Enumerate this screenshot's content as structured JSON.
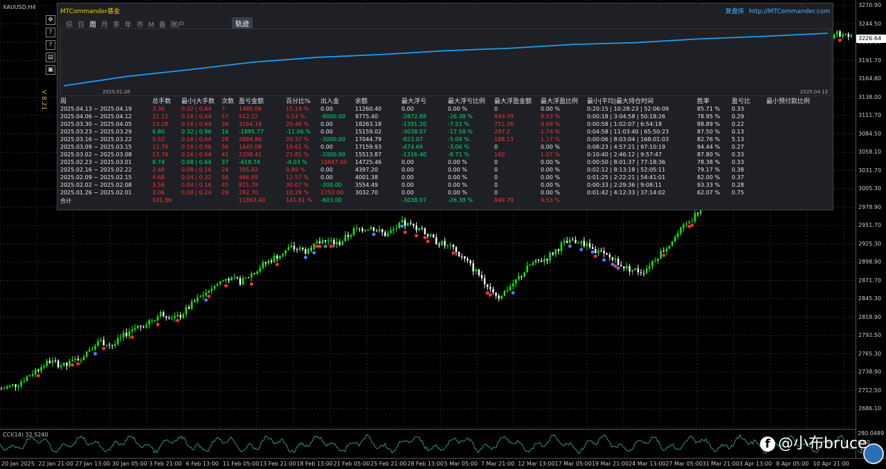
{
  "symbol": "XAUUSD,H4",
  "version": "V 8.21",
  "side_buttons": [
    "✥",
    "?",
    "?",
    "▤",
    "▣"
  ],
  "panel": {
    "title": "MTCommander基金",
    "fupan_label": "复盘侠",
    "url": "http://MTCommander.com",
    "tabs": [
      "综",
      "日",
      "周",
      "月",
      "季",
      "年",
      "市",
      "M",
      "备",
      "账户"
    ],
    "active_tab": "周",
    "trace_tab": "轨迹",
    "equity_start_label": "2025.01.26",
    "equity_end_label": "2025.04.13",
    "equity_points": [
      1000,
      1150,
      1260,
      1380,
      1455,
      1500,
      1560,
      1600,
      1660,
      1690,
      1750,
      1790,
      1840
    ]
  },
  "colors": {
    "bull": "#00ff00",
    "bear": "#ffffff",
    "equity_line": "#1e9cf0",
    "positive": "#00e070",
    "negative": "#ff3030"
  },
  "table": {
    "headers": [
      "周",
      "总手数",
      "最小|大手数",
      "次数",
      "盈亏金额",
      "百分比%",
      "出入金",
      "余额",
      "最大浮亏",
      "最大浮亏比例",
      "最大浮盈金额",
      "最大浮盈比例",
      "最小|平均|最大持仓时间",
      "胜率",
      "盈亏比",
      "最小预付款比例"
    ],
    "rows": [
      {
        "cells": [
          "2025.04.13 ~ 2025.04.19",
          "3.36",
          "0.32 | 0.64",
          "7",
          "1485.06",
          "15.19 %",
          "0.00",
          "11260.40",
          "0.00",
          "0.00 %",
          "0",
          "0.00 %",
          "0:20:15 | 10:28:23 | 52:06:09",
          "85.71 %",
          "0.33",
          ""
        ],
        "tone": [
          "w",
          "r",
          "r",
          "r",
          "r",
          "r",
          "w",
          "w",
          "w",
          "w",
          "w",
          "w",
          "w",
          "w",
          "w",
          "w"
        ]
      },
      {
        "cells": [
          "2025.04.06 ~ 2025.04.12",
          "21.12",
          "0.16 | 0.64",
          "57",
          "512.22",
          "5.53 %",
          "-9000.00",
          "9775.40",
          "-2872.88",
          "-26.38 %",
          "849.79",
          "9.53 %",
          "0:00:18 | 3:04:58 | 50:18:26",
          "78.95 %",
          "0.29",
          ""
        ],
        "tone": [
          "w",
          "r",
          "r",
          "r",
          "r",
          "r",
          "g",
          "w",
          "g",
          "g",
          "r",
          "r",
          "w",
          "w",
          "w",
          "w"
        ]
      },
      {
        "cells": [
          "2025.03.30 ~ 2025.04.05",
          "13.28",
          "0.16 | 0.64",
          "36",
          "3164.18",
          "20.48 %",
          "0.00",
          "18263.18",
          "-1351.20",
          "-7.51 %",
          "751.36",
          "4.69 %",
          "0:00:58 | 1:02:07 | 6:54:18",
          "88.89 %",
          "0.22",
          ""
        ],
        "tone": [
          "w",
          "r",
          "r",
          "r",
          "r",
          "r",
          "w",
          "w",
          "g",
          "g",
          "r",
          "r",
          "w",
          "w",
          "w",
          "w"
        ]
      },
      {
        "cells": [
          "2025.03.23 ~ 2025.03.29",
          "6.80",
          "0.32 | 0.96",
          "16",
          "-1885.77",
          "-11.06 %",
          "0.00",
          "15159.02",
          "-3038.07",
          "-17.58 %",
          "287.2",
          "1.74 %",
          "0:04:58 | 11:03:40 | 65:50:23",
          "87.50 %",
          "0.13",
          ""
        ],
        "tone": [
          "w",
          "g",
          "g",
          "g",
          "g",
          "g",
          "w",
          "w",
          "g",
          "g",
          "r",
          "r",
          "w",
          "w",
          "w",
          "w"
        ]
      },
      {
        "cells": [
          "2025.03.16 ~ 2025.03.22",
          "9.52",
          "0.16 | 0.64",
          "28",
          "2884.86",
          "20.37 %",
          "-3000.00",
          "17044.79",
          "-823.07",
          "-5.04 %",
          "188.13",
          "1.17 %",
          "0:00:06 | 8:03:04 | 168:01:03",
          "82.76 %",
          "5.13",
          ""
        ],
        "tone": [
          "w",
          "r",
          "r",
          "r",
          "r",
          "r",
          "g",
          "w",
          "g",
          "g",
          "r",
          "r",
          "w",
          "w",
          "w",
          "w"
        ]
      },
      {
        "cells": [
          "2025.03.09 ~ 2025.03.15",
          "11.76",
          "0.16 | 0.96",
          "36",
          "1645.08",
          "10.61 %",
          "0.00",
          "17159.93",
          "-474.69",
          "-3.06 %",
          "0",
          "0.00 %",
          "0:08:23 | 4:57:21 | 97:10:19",
          "94.44 %",
          "0.27",
          ""
        ],
        "tone": [
          "w",
          "r",
          "r",
          "r",
          "r",
          "r",
          "w",
          "w",
          "g",
          "g",
          "w",
          "w",
          "w",
          "w",
          "w",
          "w"
        ]
      },
      {
        "cells": [
          "2025.03.02 ~ 2025.03.08",
          "13.76",
          "0.16 | 0.64",
          "41",
          "2208.41",
          "21.81 %",
          "-2000.00",
          "15513.87",
          "-1316.40",
          "-8.71 %",
          "160",
          "1.07 %",
          "0:10:40 | 2:46:12 | 9:57:47",
          "87.80 %",
          "0.33",
          ""
        ],
        "tone": [
          "w",
          "r",
          "r",
          "r",
          "r",
          "r",
          "g",
          "w",
          "g",
          "g",
          "r",
          "r",
          "w",
          "w",
          "w",
          "w"
        ]
      },
      {
        "cells": [
          "2025.02.23 ~ 2025.03.01",
          "8.74",
          "0.08 | 0.64",
          "37",
          "-618.74",
          "-4.03 %",
          "10847.00",
          "14725.46",
          "0.00",
          "0.00 %",
          "0",
          "0.00 %",
          "0:00:50 | 8:01:37 | 77:18:36",
          "78.38 %",
          "0.33",
          ""
        ],
        "tone": [
          "w",
          "g",
          "g",
          "g",
          "g",
          "g",
          "r",
          "w",
          "w",
          "w",
          "w",
          "w",
          "w",
          "w",
          "w",
          "w"
        ]
      },
      {
        "cells": [
          "2025.02.16 ~ 2025.02.22",
          "2.48",
          "0.08 | 0.16",
          "24",
          "395.82",
          "9.89 %",
          "0.00",
          "4397.20",
          "0.00",
          "0.00 %",
          "0",
          "0.00 %",
          "0:02:12 | 8:13:18 | 52:05:11",
          "79.17 %",
          "0.38",
          ""
        ],
        "tone": [
          "w",
          "r",
          "r",
          "r",
          "r",
          "r",
          "w",
          "w",
          "w",
          "w",
          "w",
          "w",
          "w",
          "w",
          "w",
          "w"
        ]
      },
      {
        "cells": [
          "2025.02.09 ~ 2025.02.15",
          "4.68",
          "0.04 | 0.32",
          "56",
          "446.69",
          "12.57 %",
          "0.00",
          "4001.38",
          "0.00",
          "0.00 %",
          "0",
          "0.00 %",
          "0:01:25 | 2:22:21 | 54:41:01",
          "82.00 %",
          "0.37",
          ""
        ],
        "tone": [
          "w",
          "r",
          "r",
          "r",
          "r",
          "r",
          "w",
          "w",
          "w",
          "w",
          "w",
          "w",
          "w",
          "w",
          "w",
          "w"
        ]
      },
      {
        "cells": [
          "2025.02.02 ~ 2025.02.08",
          "3.56",
          "0.04 | 0.16",
          "45",
          "821.79",
          "30.07 %",
          "-300.00",
          "3554.49",
          "0.00",
          "0.00 %",
          "0",
          "0.00 %",
          "0:00:33 | 2:29:36 | 9:08:11",
          "93.33 %",
          "0.28",
          ""
        ],
        "tone": [
          "w",
          "r",
          "r",
          "r",
          "r",
          "r",
          "g",
          "w",
          "w",
          "w",
          "w",
          "w",
          "w",
          "w",
          "w",
          "w"
        ]
      },
      {
        "cells": [
          "2025.01.26 ~ 2025.02.01",
          "3.06",
          "0.08 | 0.24",
          "29",
          "282.70",
          "10.28 %",
          "2750.00",
          "3032.70",
          "0.00",
          "0.00 %",
          "0",
          "0.00 %",
          "0:01:42 | 4:12:33 | 37:14:02",
          "62.07 %",
          "0.75",
          ""
        ],
        "tone": [
          "w",
          "r",
          "r",
          "r",
          "r",
          "r",
          "r",
          "w",
          "w",
          "w",
          "w",
          "w",
          "w",
          "w",
          "w",
          "w"
        ]
      }
    ],
    "total": {
      "cells": [
        "合计",
        "101.86",
        "",
        "",
        "11863.40",
        "141.81 %",
        "-603.00",
        "",
        "-3038.07",
        "-26.38 %",
        "849.79",
        "9.53 %",
        "",
        "",
        "",
        ""
      ],
      "tone": [
        "w",
        "r",
        "r",
        "r",
        "r",
        "r",
        "g",
        "w",
        "g",
        "g",
        "r",
        "r",
        "w",
        "w",
        "w",
        "w"
      ]
    }
  },
  "price_axis": {
    "ticks": [
      "3270.90",
      "3244.50",
      "3218.06",
      "3191.70",
      "3164.80",
      "3138.00",
      "3111.70",
      "3084.50",
      "3058.10",
      "3031.70",
      "3005.30",
      "2978.90",
      "2951.70",
      "2925.30",
      "2898.90",
      "2871.70",
      "2845.30",
      "2818.90",
      "2792.50",
      "2765.30",
      "2738.90",
      "2712.50",
      "2686.10"
    ],
    "current": "3226.64"
  },
  "cci": {
    "label": "CCI(14) 32.5240",
    "ticks": [
      "280.0489",
      "0.00",
      "-292.574"
    ]
  },
  "time_axis": [
    "20 Jan 2025",
    "22 Jan 21:00",
    "27 Jan 13:00",
    "30 Jan 05:00",
    "3 Feb 21:00",
    "6 Feb 13:00",
    "11 Feb 05:00",
    "13 Feb 21:00",
    "18 Feb 13:00",
    "21 Feb 05:00",
    "25 Feb 21:00",
    "28 Feb 13:00",
    "5 Mar 05:00",
    "7 Mar 21:00",
    "12 Mar 13:00",
    "17 Mar 05:00",
    "19 Mar 21:00",
    "24 Mar 13:00",
    "27 Mar 05:00",
    "31 Mar 21:00",
    "3 Apr 13:00",
    "8 Apr 05:00",
    "10 Apr 21:00"
  ],
  "watermark": "@小布bruce",
  "series": {
    "price_path": [
      2715,
      2722,
      2740,
      2755,
      2748,
      2762,
      2785,
      2778,
      2800,
      2810,
      2825,
      2818,
      2840,
      2860,
      2875,
      2870,
      2890,
      2905,
      2920,
      2915,
      2930,
      2925,
      2945,
      2950,
      2938,
      2955,
      2948,
      2930,
      2920,
      2900,
      2875,
      2848,
      2870,
      2895,
      2905,
      2925,
      2930,
      2915,
      2905,
      2890,
      2885,
      2910,
      2935,
      2960,
      2990,
      3020,
      3050,
      3080,
      3110,
      3150,
      3180,
      3210,
      3230,
      3225
    ]
  }
}
